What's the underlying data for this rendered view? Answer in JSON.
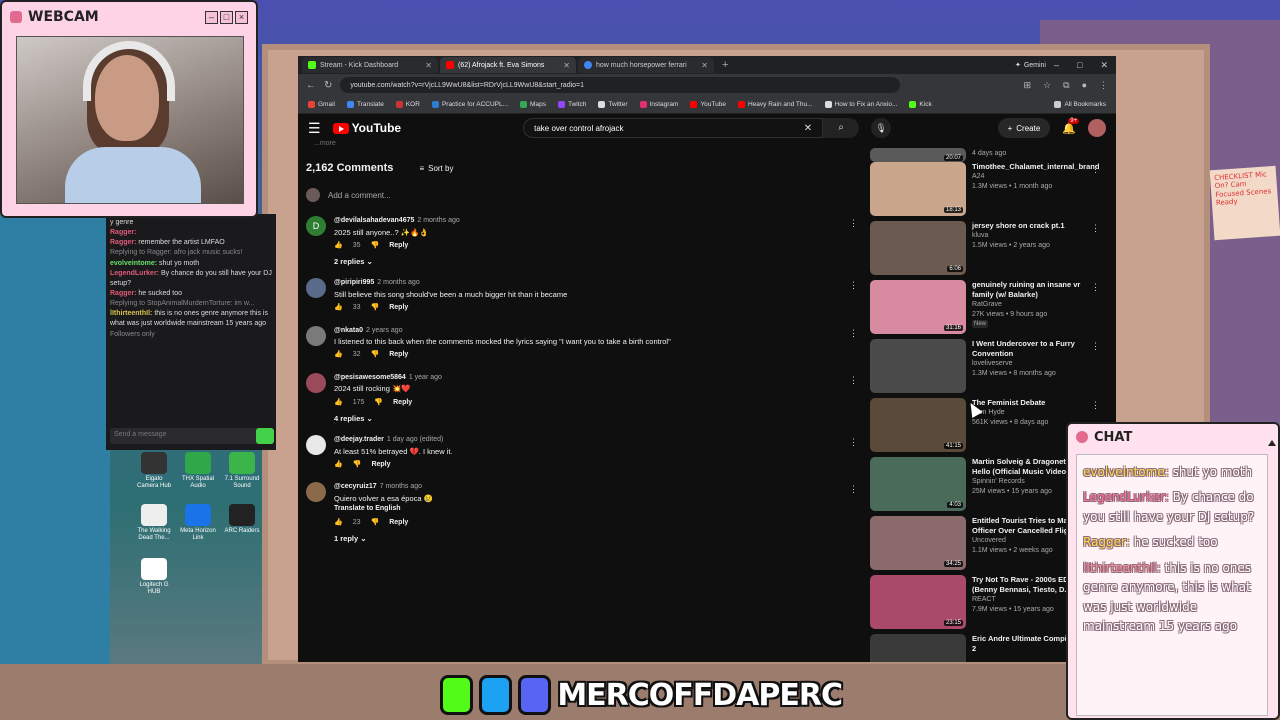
{
  "webcam": {
    "title": "WEBCAM"
  },
  "chat_overlay": {
    "title": "CHAT",
    "messages": [
      {
        "user": "evolveintome:",
        "text": " shut yo moth"
      },
      {
        "user": "LegendLurker:",
        "text": " By chance do you still have your DJ setup?"
      },
      {
        "user": "Ragger:",
        "text": " he sucked too"
      },
      {
        "user": "lIthirteenthIl:",
        "text": " this is no ones genre anymore, this is what was just worldwide mainstream 15 years ago"
      }
    ]
  },
  "left_chat": {
    "lines": [
      {
        "user": "",
        "text": "y genre",
        "reply": ""
      },
      {
        "user": "Ragger:",
        "text": "",
        "reply": ""
      },
      {
        "user": "Ragger:",
        "text": " remember the artist LMFAO",
        "reply": ""
      },
      {
        "user": "",
        "text": "",
        "reply": "Replying to Ragger: afro jack music sucks!"
      },
      {
        "user": "evolveintome:",
        "text": " shut yo moth",
        "reply": ""
      },
      {
        "user": "LegendLurker:",
        "text": " By chance do you still have your DJ setup?",
        "reply": ""
      },
      {
        "user": "Ragger:",
        "text": " he sucked too",
        "reply": ""
      },
      {
        "user": "",
        "text": "",
        "reply": "Replying to StopAnimalMurdernTorture: im w..."
      },
      {
        "user": "lIthirteenthIl:",
        "text": " this is no ones genre anymore this is what was just worldwide mainstream 15 years ago",
        "reply": ""
      },
      {
        "user": "",
        "text": "Followers only",
        "reply": ""
      }
    ],
    "send_placeholder": "Send a message",
    "chat_button": "Chat"
  },
  "desktop_icons": [
    {
      "label": "Elgato Camera Hub"
    },
    {
      "label": "THX Spatial Audio"
    },
    {
      "label": "7.1 Surround Sound"
    },
    {
      "label": "The Walking Dead The..."
    },
    {
      "label": "Meta Horizon Link"
    },
    {
      "label": "ARC Raiders"
    },
    {
      "label": "Logitech G HUB"
    }
  ],
  "browser": {
    "tabs": [
      {
        "label": "Stream - Kick Dashboard",
        "color": "#53fc18"
      },
      {
        "label": "(62) Afrojack ft. Eva Simons",
        "color": "#ff0000"
      },
      {
        "label": "how much horsepower ferrari",
        "color": "#4285f4"
      }
    ],
    "gemini": "Gemini",
    "url": "youtube.com/watch?v=rVjcLL9WwU8&list=RDrVjcLL9WwU8&start_radio=1",
    "bookmarks": [
      "Gmail",
      "Translate",
      "KOR",
      "Practice for ACCUPL...",
      "Maps",
      "Twitch",
      "Twitter",
      "Instagram",
      "YouTube",
      "Heavy Rain and Thu...",
      "How to Fix an Anxio...",
      "Kick"
    ],
    "all_bookmarks": "All Bookmarks"
  },
  "youtube": {
    "logo": "YouTube",
    "search_value": "take over control afrojack",
    "create": "Create",
    "notif_badge": "9+",
    "more_link": "...more",
    "comments_count": "2,162 Comments",
    "sort_label": "Sort by",
    "add_comment": "Add a comment...",
    "comments": [
      {
        "handle": "@devilalsahadevan4675",
        "time": "2 months ago",
        "text": "2025 still anyone..? ✨🔥👌",
        "likes": "35",
        "avatar": "D",
        "avatar_color": "#2e7d32",
        "replies": "2 replies",
        "translate": ""
      },
      {
        "handle": "@piripiri995",
        "time": "2 months ago",
        "text": "Still believe this song should've been a much bigger hit than it became",
        "likes": "33",
        "avatar": "",
        "avatar_color": "#5a6b8a",
        "replies": "",
        "translate": ""
      },
      {
        "handle": "@nkata0",
        "time": "2 years ago",
        "text": "I listened to this back when the comments mocked the lyrics saying \"I want you to take a birth control\"",
        "likes": "32",
        "avatar": "",
        "avatar_color": "#7a7a7a",
        "replies": "",
        "translate": ""
      },
      {
        "handle": "@pesisawesome5864",
        "time": "1 year ago",
        "text": "2024 still rocking 💥❤️",
        "likes": "175",
        "avatar": "",
        "avatar_color": "#9a4a5a",
        "replies": "4 replies",
        "translate": ""
      },
      {
        "handle": "@deejay.trader",
        "time": "1 day ago (edited)",
        "text": "At least 51% betrayed 💔. I knew it.",
        "likes": "",
        "avatar": "",
        "avatar_color": "#e8e8e8",
        "replies": "",
        "translate": ""
      },
      {
        "handle": "@cecyruiz17",
        "time": "7 months ago",
        "text": "Quiero volver a esa época 😢",
        "likes": "23",
        "avatar": "",
        "avatar_color": "#8a6a4a",
        "replies": "1 reply",
        "translate": "Translate to English"
      }
    ],
    "reply_label": "Reply",
    "recs_top_meta": "4 days ago",
    "recs_top_duration": "20:07",
    "recommendations": [
      {
        "title": "Timothee_Chalamet_internal_brand_marketing_meeting_Mart...",
        "channel": "A24",
        "meta": "1.3M views • 1 month ago",
        "duration": "18:13",
        "new": "",
        "color": "#c9a68c"
      },
      {
        "title": "jersey shore on crack pt.1",
        "channel": "kluva",
        "meta": "1.5M views • 2 years ago",
        "duration": "6:06",
        "new": "",
        "color": "#6a5a50"
      },
      {
        "title": "genuinely ruining an insane vr family (w/ Balarke)",
        "channel": "RatGrave",
        "meta": "27K views • 9 hours ago",
        "duration": "31:16",
        "new": "New",
        "color": "#d88aa0"
      },
      {
        "title": "I Went Undercover to a Furry Convention",
        "channel": "loveliveserve",
        "meta": "1.3M views • 8 months ago",
        "duration": "",
        "new": "",
        "color": "#4a4a4a"
      },
      {
        "title": "The Feminist Debate",
        "channel": "Sam Hyde",
        "meta": "561K views • 8 days ago",
        "duration": "41:15",
        "new": "",
        "color": "#5a4a3a"
      },
      {
        "title": "Martin Solveig & Dragonette - Hello (Official Music Video)",
        "channel": "Spinnin' Records",
        "meta": "25M views • 15 years ago",
        "duration": "4:03",
        "new": "",
        "color": "#4a6a5a"
      },
      {
        "title": "Entitled Tourist Tries to Make Officer Over Cancelled Flig...",
        "channel": "Uncovered",
        "meta": "1.1M views • 2 weeks ago",
        "duration": "34:25",
        "new": "",
        "color": "#8a6a6a"
      },
      {
        "title": "Try Not To Rave - 2000s EDM (Benny Bennasi, Tiesto, D...",
        "channel": "REACT",
        "meta": "7.9M views • 15 years ago",
        "duration": "23:15",
        "new": "",
        "color": "#aa4a6a"
      },
      {
        "title": "Eric Andre Ultimate Compilation 2",
        "channel": "",
        "meta": "",
        "duration": "",
        "new": "",
        "color": "#3a3a3a"
      }
    ]
  },
  "banner": {
    "handle": "MERCOFFDAPERC"
  },
  "bg_note": "CHECKLIST Mic On? Cam Focused Scenes Ready"
}
